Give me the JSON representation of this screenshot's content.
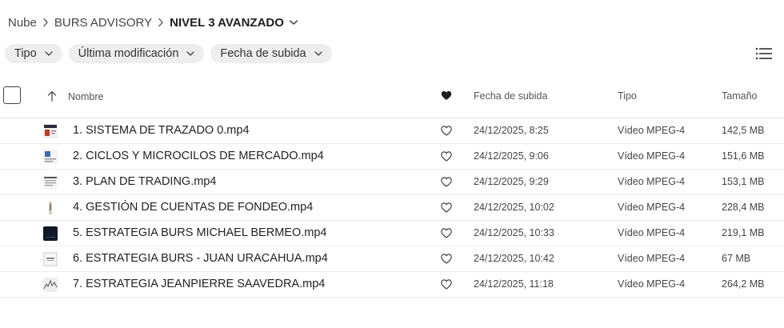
{
  "breadcrumb": {
    "root": "Nube",
    "parent": "BURS ADVISORY",
    "current": "NIVEL 3 AVANZADO"
  },
  "filters": [
    {
      "label": "Tipo"
    },
    {
      "label": "Última modificación"
    },
    {
      "label": "Fecha de subida"
    }
  ],
  "table": {
    "columns": {
      "name": "Nombre",
      "date": "Fecha de subida",
      "type": "Tipo",
      "size": "Tamaño"
    },
    "rows": [
      {
        "name": "1. SISTEMA DE TRAZADO 0.mp4",
        "date": "24/12/2025, 8:25",
        "type": "Vídeo MPEG-4",
        "size": "142,5 MB",
        "thumb": "slide"
      },
      {
        "name": "2. CICLOS Y MICROCILOS DE MERCADO.mp4",
        "date": "24/12/2025, 9:06",
        "type": "Vídeo MPEG-4",
        "size": "151,6 MB",
        "thumb": "slide"
      },
      {
        "name": "3. PLAN DE TRADING.mp4",
        "date": "24/12/2025, 9:29",
        "type": "Vídeo MPEG-4",
        "size": "153,1 MB",
        "thumb": "doc"
      },
      {
        "name": "4. GESTIÓN DE CUENTAS DE FONDEO.mp4",
        "date": "24/12/2025, 10:02",
        "type": "Vídeo MPEG-4",
        "size": "228,4 MB",
        "thumb": "portrait"
      },
      {
        "name": "5. ESTRATEGIA BURS MICHAEL BERMEO.mp4",
        "date": "24/12/2025, 10:33",
        "type": "Vídeo MPEG-4",
        "size": "219,1 MB",
        "thumb": "dark"
      },
      {
        "name": "6. ESTRATEGIA BURS - JUAN URACAHUA.mp4",
        "date": "24/12/2025, 10:42",
        "type": "Vídeo MPEG-4",
        "size": "67 MB",
        "thumb": "doc"
      },
      {
        "name": "7. ESTRATEGIA JEANPIERRE SAAVEDRA.mp4",
        "date": "24/12/2025, 11:18",
        "type": "Vídeo MPEG-4",
        "size": "264,2 MB",
        "thumb": "chart"
      }
    ]
  },
  "icons": {
    "breadcrumb_separator": "chevron-right-icon",
    "dropdown": "chevron-down-icon",
    "sort": "arrow-up-icon",
    "favorite_header": "heart-filled-icon",
    "favorite_row": "heart-outline-icon",
    "view": "list-view-icon"
  }
}
